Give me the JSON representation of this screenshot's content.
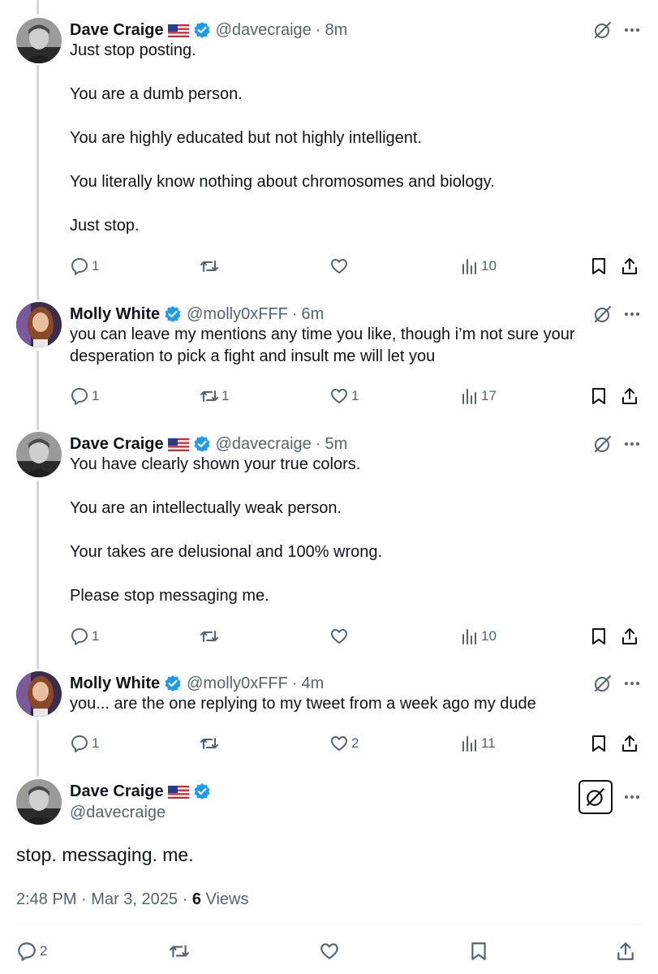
{
  "tweets": [
    {
      "name": "Dave Craige",
      "handle": "@davecraige",
      "time": "8m",
      "paragraphs": [
        "Just stop posting.",
        "You are a dumb person.",
        "You are highly educated but not highly intelligent.",
        "You literally know nothing about chromosomes and biology.",
        "Just stop."
      ],
      "replies": "1",
      "reposts": "",
      "likes": "",
      "views": "10"
    },
    {
      "name": "Molly White",
      "handle": "@molly0xFFF",
      "time": "6m",
      "paragraphs": [
        "you can leave my mentions any time you like, though i’m not sure your desperation to pick a fight and insult me will let you"
      ],
      "replies": "1",
      "reposts": "1",
      "likes": "1",
      "views": "17"
    },
    {
      "name": "Dave Craige",
      "handle": "@davecraige",
      "time": "5m",
      "paragraphs": [
        "You have clearly shown your true colors.",
        "You are an intellectually weak person.",
        "Your takes are delusional and 100% wrong.",
        "Please stop messaging me."
      ],
      "replies": "1",
      "reposts": "",
      "likes": "",
      "views": "10"
    },
    {
      "name": "Molly White",
      "handle": "@molly0xFFF",
      "time": "4m",
      "paragraphs": [
        "you... are the one replying to my tweet from a week ago my dude"
      ],
      "replies": "1",
      "reposts": "",
      "likes": "2",
      "views": "11"
    }
  ],
  "separator": "·",
  "main_tweet": {
    "name": "Dave Craige",
    "handle": "@davecraige",
    "text": "stop. messaging. me.",
    "time": "2:48 PM",
    "date": "Mar 3, 2025",
    "views_count": "6",
    "views_label": "Views",
    "replies": "2"
  },
  "colors": {
    "text": "#0f1419",
    "secondary": "#536471",
    "verified": "#1d9bf0",
    "thread_line": "#cfd9de"
  },
  "icons": [
    "flag-us-icon",
    "verified-badge-icon",
    "grok-icon",
    "more-icon",
    "reply-icon",
    "repost-icon",
    "like-icon",
    "views-icon",
    "bookmark-icon",
    "share-icon"
  ]
}
